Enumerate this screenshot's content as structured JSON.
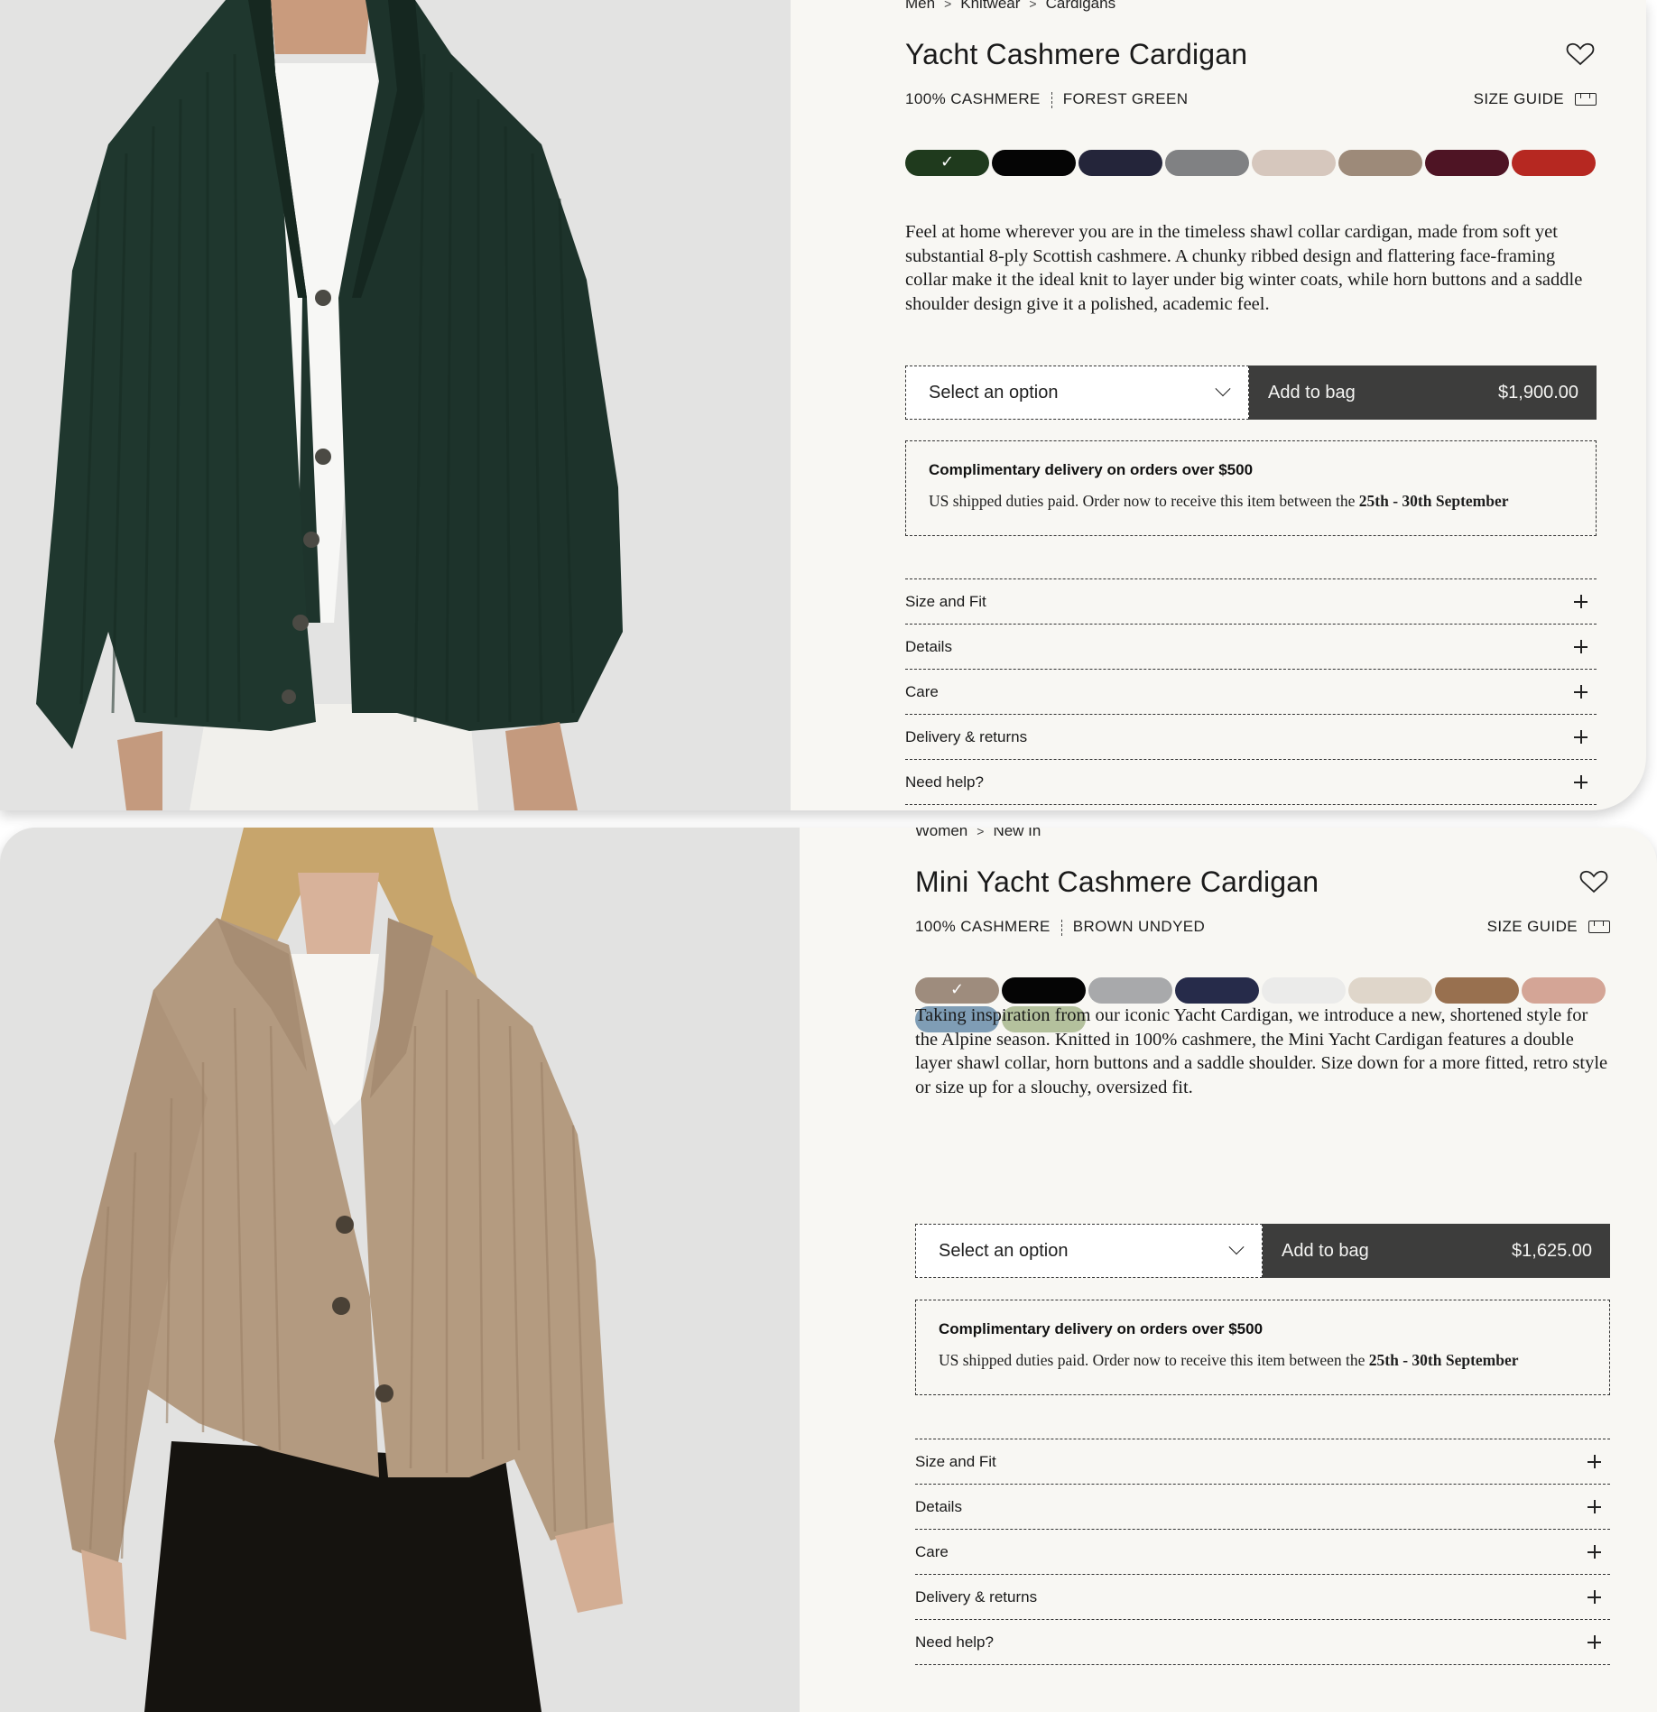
{
  "products": [
    {
      "breadcrumb": [
        "Men",
        "Knitwear",
        "Cardigans"
      ],
      "title": "Yacht Cashmere Cardigan",
      "material": "100% CASHMERE",
      "colour_name": "FOREST GREEN",
      "size_guide_label": "SIZE GUIDE",
      "swatches": [
        "#1f3a1d",
        "#050505",
        "#24253a",
        "#808183",
        "#d6c7bd",
        "#9d8a79",
        "#4e1424",
        "#b62821"
      ],
      "selected_swatch": 0,
      "description": "Feel at home wherever you are in the timeless shawl collar cardigan, made from soft yet substantial 8-ply Scottish cashmere. A chunky ribbed design and flattering face-framing collar make it the ideal knit to layer under big winter coats, while horn buttons and a saddle shoulder design give it a polished, academic feel.",
      "select_placeholder": "Select an option",
      "add_to_bag_label": "Add to bag",
      "price": "$1,900.00",
      "delivery_heading": "Complimentary delivery on orders over $500",
      "delivery_text": "US shipped duties paid. Order now to receive this item between the",
      "delivery_dates": "25th - 30th September",
      "accordion": [
        "Size and Fit",
        "Details",
        "Care",
        "Delivery & returns",
        "Need help?"
      ]
    },
    {
      "breadcrumb": [
        "Women",
        "New In"
      ],
      "title": "Mini Yacht Cashmere Cardigan",
      "material": "100% CASHMERE",
      "colour_name": "BROWN UNDYED",
      "size_guide_label": "SIZE GUIDE",
      "swatches": [
        "#9e8c7d",
        "#050505",
        "#a8a9ab",
        "#262b4a",
        "#ebebea",
        "#dfd6ca",
        "#98704f",
        "#d4a596",
        "#7f9db5",
        "#b4c19d"
      ],
      "selected_swatch": 0,
      "description": "Taking inspiration from our iconic Yacht Cardigan, we introduce a new, shortened style for the Alpine season. Knitted in 100% cashmere, the Mini Yacht Cardigan features a double layer shawl collar, horn buttons and a saddle shoulder. Size down for a more fitted, retro style or size up for a slouchy, oversized fit.",
      "select_placeholder": "Select an option",
      "add_to_bag_label": "Add to bag",
      "price": "$1,625.00",
      "delivery_heading": "Complimentary delivery on orders over $500",
      "delivery_text": "US shipped duties paid. Order now to receive this item between the",
      "delivery_dates": "25th - 30th September",
      "accordion": [
        "Size and Fit",
        "Details",
        "Care",
        "Delivery & returns",
        "Need help?"
      ]
    }
  ]
}
